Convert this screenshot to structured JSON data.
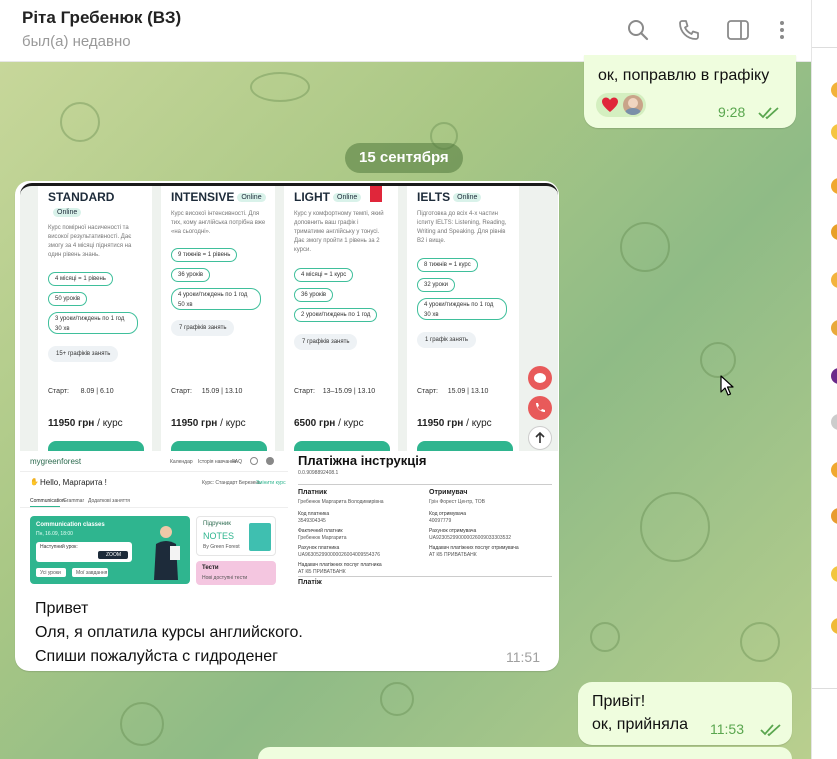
{
  "header": {
    "contact_name": "Ріта Гребенюк (ВЗ)",
    "contact_status": "был(а) недавно",
    "icons": [
      "search-icon",
      "phone-icon",
      "sidebar-toggle-icon",
      "more-vert-icon"
    ]
  },
  "messages": {
    "prev_out": {
      "text": "ок, поправлю в графіку",
      "time": "9:28",
      "reactions": [
        "heart-reaction",
        "avatar-reaction"
      ]
    },
    "date_separator": "15 сентября",
    "photo_msg": {
      "caption_line1": "Привет",
      "caption_line2": "Оля, я оплатила курсы английского.",
      "caption_line3": "Спиши пожалуйста с гидроденег",
      "time": "11:51"
    },
    "reply_out": {
      "line1": "Привіт!",
      "line2": "ок, прийняла",
      "time": "11:53"
    }
  },
  "collage": {
    "cards": [
      {
        "title": "STANDARD",
        "badge": "Online",
        "desc": "Курс помірної насиченості та високої результативності. Дає змогу за 4 місяці піднятися на один рівень знань.",
        "chips": [
          "4 місяці = 1 рівень",
          "50 уроків",
          "3 уроки/тиждень по 1 год 30 хв"
        ],
        "schedule": "15+ графіків занять",
        "start_label": "Старт:",
        "start_value": "8.09 | 6.10",
        "price": "11950 грн",
        "price_unit": "/ курс"
      },
      {
        "title": "INTENSIVE",
        "badge": "Online",
        "desc": "Курс високої інтенсивності. Для тих, кому англійська потрібна вже «на сьогодні».",
        "chips": [
          "9 тижнів = 1 рівень",
          "36 уроків",
          "4 уроки/тиждень по 1 год 50 хв"
        ],
        "schedule": "7 графіків занять",
        "start_label": "Старт:",
        "start_value": "15.09 | 13.10",
        "price": "11950 грн",
        "price_unit": "/ курс"
      },
      {
        "title": "LIGHT",
        "badge": "Online",
        "desc": "Курс у комфортному темпі, який доповнить ваш графік і триматиме англійську у тонусі. Дає змогу пройти 1 рівень за 2 курси.",
        "chips": [
          "4 місяці = 1 курс",
          "36 уроків",
          "2 уроки/тиждень по 1 год"
        ],
        "schedule": "7 графіків занять",
        "start_label": "Старт:",
        "start_value": "13–15.09 | 13.10",
        "price": "6500 грн",
        "price_unit": "/ курс"
      },
      {
        "title": "IELTS",
        "badge": "Online",
        "desc": "Підготовка до всіх 4-х частин іспиту IELTS: Listening, Reading, Writing and Speaking. Для рівнів B2 і вище.",
        "chips": [
          "8 тижнів = 1 курс",
          "32 уроки",
          "4 уроки/тиждень по 1 год 30 хв"
        ],
        "schedule": "1 графік занять",
        "start_label": "Старт:",
        "start_value": "15.09 | 13.10",
        "price": "11950 грн",
        "price_unit": "/ курс"
      }
    ],
    "app": {
      "logo": "mygreenforest",
      "nav": [
        "Календар",
        "Історія навчання",
        "FAQ"
      ],
      "greeting": "Hello, Маргарита !",
      "course": "Курс: Стандарт Березень",
      "course_link": "Змінити курс",
      "tabs": [
        "Communication",
        "Grammar",
        "Додаткові заняття"
      ],
      "class_title": "Communication classes",
      "class_sub": "Пн, 16.09, 18:00",
      "next_lesson": "Наступний урок:",
      "zoom_btn": "ZOOM",
      "btn1": "Усі уроки",
      "btn2": "Мої завдання",
      "notes_label": "Підручник",
      "notes_title": "NOTES",
      "notes_sub": "By Green Forest",
      "tests_title": "Тести",
      "tests_sub": "Нові доступні тести"
    },
    "payment": {
      "title": "Платіжна інструкція",
      "number": "0.0.9098892408.1",
      "payer_heading": "Платник",
      "recipient_heading": "Отримувач",
      "payer_name": "Гребенюк Маргарита Володимирівна",
      "recipient_name": "Грін Форест Центр, ТОВ",
      "payer_code_label": "Код платника",
      "payer_code": "3549304345",
      "recipient_code_label": "Код отримувача",
      "recipient_code": "40097779",
      "actual_payer_label": "Фактичний платник",
      "actual_payer": "Гребенюк Маргарита",
      "recipient_account_label": "Рахунок отримувача",
      "recipient_account": "UA923052990000026009033303532",
      "payer_account_label": "Рахунок платника",
      "payer_account": "UA963052990000026004009554376",
      "recipient_bank_label": "Надавач платіжних послуг отримувача",
      "recipient_bank": "АТ КБ ПРИВАТБАНК",
      "payer_bank_label": "Надавач платіжних послуг платника",
      "payer_bank": "АТ КБ ПРИВАТБАНК",
      "payment_heading": "Платіж"
    }
  },
  "colors": {
    "outgoing_bubble": "#effdde",
    "incoming_bubble": "#ffffff",
    "accent_green": "#2fb58f",
    "check_green": "#5aa64f"
  }
}
